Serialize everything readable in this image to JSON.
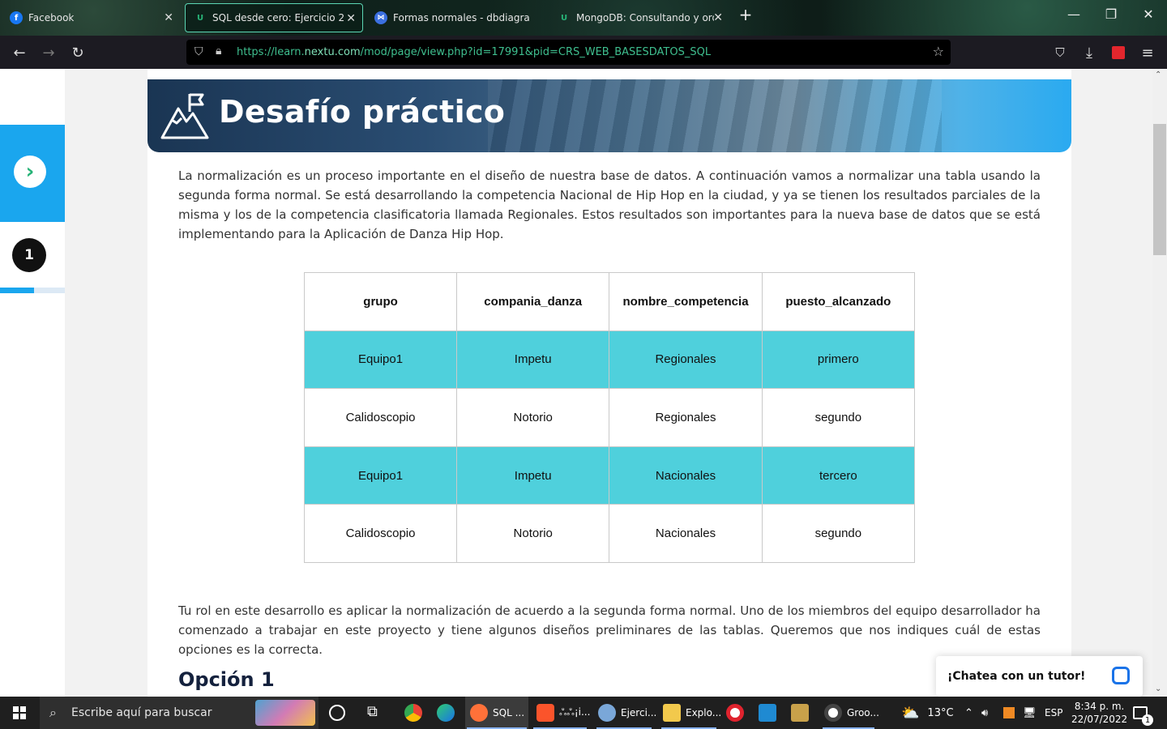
{
  "browser": {
    "tabs": [
      {
        "title": "Facebook",
        "icon": "facebook-icon",
        "color": "#1877f2"
      },
      {
        "title": "SQL desde cero: Ejercicio 2",
        "icon": "nextu-icon",
        "color": "#27b377"
      },
      {
        "title": "Formas normales - dbdiagram.i",
        "icon": "dbdiagram-icon",
        "color": "#3b6fe0"
      },
      {
        "title": "MongoDB: Consultando y orde",
        "icon": "nextu-icon",
        "color": "#27b377"
      }
    ],
    "new_tab": "+",
    "url_prefix": "https://learn.",
    "url_host": "nextu.com",
    "url_rest": "/mod/page/view.php?id=17991&pid=CRS_WEB_BASESDATOS_SQL"
  },
  "sidebar": {
    "next_symbol": "›",
    "step_number": "1",
    "progress": 0.52
  },
  "banner": {
    "title": "Desafío práctico"
  },
  "intro": "La normalización es un proceso importante en el diseño de nuestra base de datos. A continuación vamos a normalizar una tabla usando la segunda forma normal. Se está desarrollando la competencia Nacional de Hip Hop en la ciudad, y ya se tienen los resultados parciales de la misma y los de la competencia clasificatoria llamada Regionales. Estos resultados son importantes para la nueva base de datos que se está implementando para la Aplicación de Danza Hip Hop.",
  "table": {
    "headers": [
      "grupo",
      "compania_danza",
      "nombre_competencia",
      "puesto_alcanzado"
    ],
    "rows": [
      [
        "Equipo1",
        "Impetu",
        "Regionales",
        "primero"
      ],
      [
        "Calidoscopio",
        "Notorio",
        "Regionales",
        "segundo"
      ],
      [
        "Equipo1",
        "Impetu",
        "Nacionales",
        "tercero"
      ],
      [
        "Calidoscopio",
        "Notorio",
        "Nacionales",
        "segundo"
      ]
    ],
    "highlight_color": "#4fd0dc"
  },
  "body2": "Tu rol en este desarrollo es aplicar la normalización de acuerdo a la segunda forma normal. Uno de los miembros del equipo desarrollador ha comenzado a trabajar en este proyecto y tiene algunos diseños preliminares de las tablas. Queremos que nos indiques cuál de estas opciones es la correcta.",
  "option_heading": "Opción 1",
  "chat": {
    "label": "¡Chatea con un tutor!"
  },
  "taskbar": {
    "search_placeholder": "Escribe aquí para buscar",
    "apps": [
      {
        "label": "SQL ...",
        "icon": "firefox-icon",
        "color": "#ff7139"
      },
      {
        "label": "ஃஃ¡i...",
        "icon": "brave-icon",
        "color": "#fb542b"
      },
      {
        "label": "Ejerci...",
        "icon": "paint-icon",
        "color": "#7aa7d8"
      },
      {
        "label": "Explo...",
        "icon": "folder-icon",
        "color": "#f2c94c"
      },
      {
        "label": "Groo...",
        "icon": "groove-icon",
        "color": "#c64b8c"
      }
    ],
    "weather": "13°C",
    "lang": "ESP",
    "time": "8:34 p. m.",
    "date": "22/07/2022",
    "notifications": "1"
  }
}
